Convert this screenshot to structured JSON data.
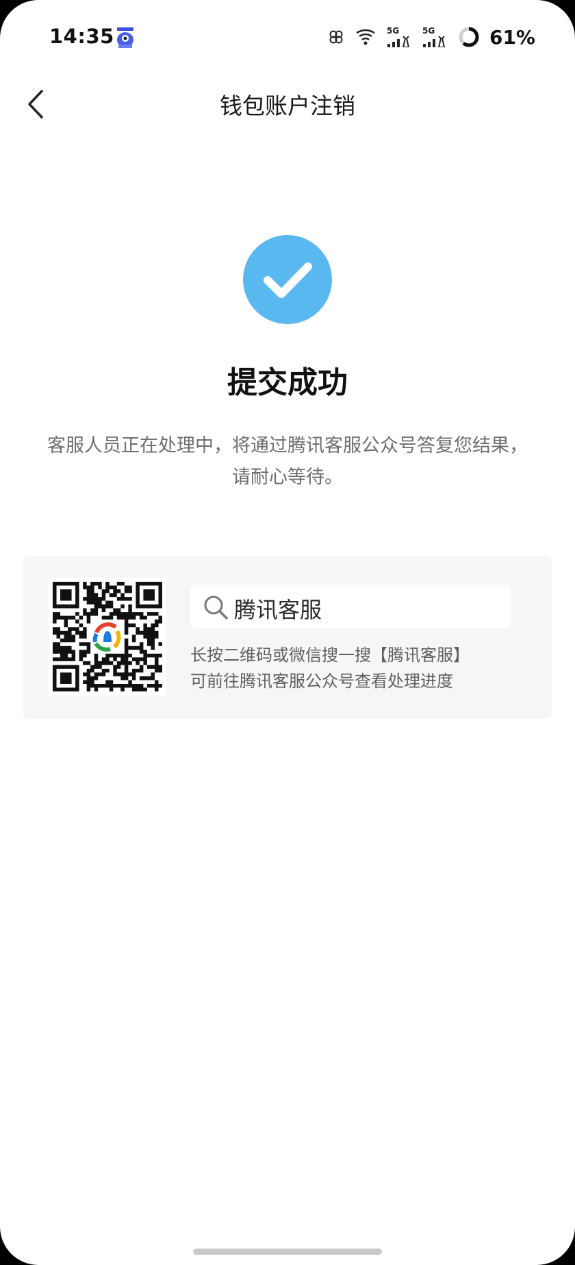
{
  "status_bar": {
    "time": "14:35",
    "signal_1": "5G",
    "signal_2": "5G",
    "battery": "61%"
  },
  "nav": {
    "title": "钱包账户注销"
  },
  "success": {
    "title": "提交成功",
    "description_line1": "客服人员正在处理中，将通过腾讯客服公众号答复您结果，",
    "description_line2": "请耐心等待。",
    "icon_color": "#5AB8F0"
  },
  "qr_card": {
    "search_text": "腾讯客服",
    "hint_line1": "长按二维码或微信搜一搜【腾讯客服】",
    "hint_line2": "可前往腾讯客服公众号查看处理进度"
  }
}
